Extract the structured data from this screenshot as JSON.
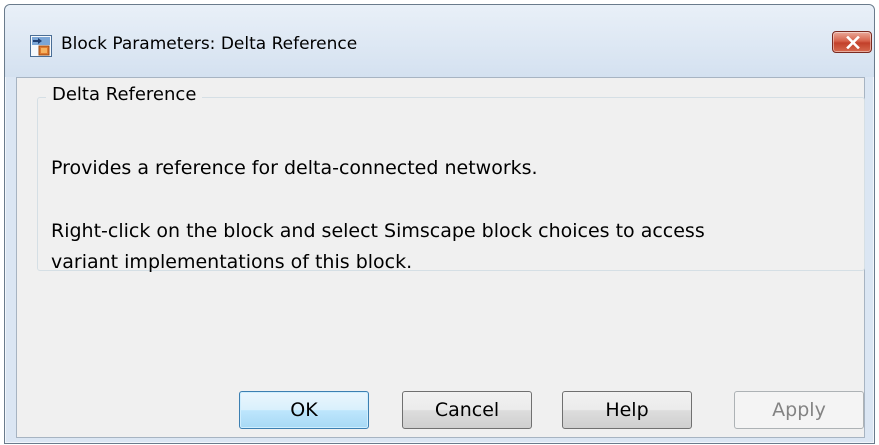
{
  "window": {
    "title": "Block Parameters: Delta Reference",
    "icon": "simulink-block-icon",
    "close_icon": "close-icon"
  },
  "group": {
    "legend": "Delta Reference",
    "description_line1": "Provides a reference for delta-connected networks.",
    "description_line2": "Right-click on the block and select Simscape block choices to access",
    "description_line3": "variant implementations of this block."
  },
  "buttons": {
    "ok": "OK",
    "cancel": "Cancel",
    "help": "Help",
    "apply": "Apply"
  },
  "colors": {
    "titlebar": "#d4e1f0",
    "close_button": "#c2402a",
    "client_background": "#f0f0f0",
    "default_button_border": "#3c7fb1"
  }
}
